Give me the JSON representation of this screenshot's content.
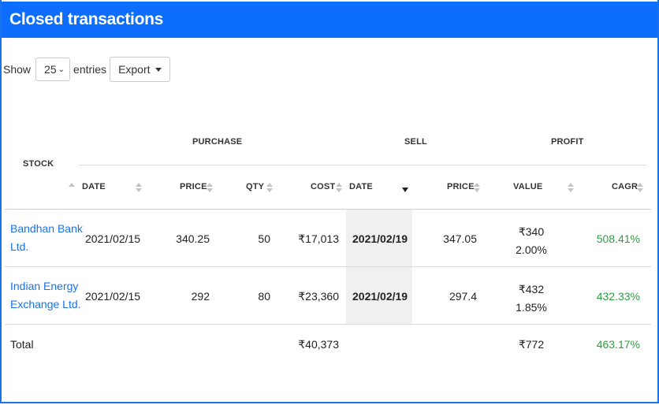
{
  "header": {
    "title": "Closed transactions"
  },
  "controls": {
    "show_label": "Show",
    "entries_value": "25",
    "entries_label": "entries",
    "export_label": "Export"
  },
  "groups": {
    "purchase": "PURCHASE",
    "sell": "SELL",
    "profit": "PROFIT"
  },
  "columns": {
    "stock": "STOCK",
    "purchase_date": "DATE",
    "purchase_price": "PRICE",
    "qty": "QTY",
    "cost": "COST",
    "sell_date": "DATE",
    "sell_price": "PRICE",
    "value": "VALUE",
    "cagr": "CAGR"
  },
  "rows": [
    {
      "stock_line1": "Bandhan Bank",
      "stock_line2": "Ltd.",
      "purchase_date": "2021/02/15",
      "purchase_price": "340.25",
      "qty": "50",
      "cost": "₹17,013",
      "sell_date": "2021/02/19",
      "sell_price": "347.05",
      "value": "₹340",
      "value_pct": "2.00%",
      "cagr": "508.41%"
    },
    {
      "stock_line1": "Indian Energy",
      "stock_line2": "Exchange Ltd.",
      "purchase_date": "2021/02/15",
      "purchase_price": "292",
      "qty": "80",
      "cost": "₹23,360",
      "sell_date": "2021/02/19",
      "sell_price": "297.4",
      "value": "₹432",
      "value_pct": "1.85%",
      "cagr": "432.33%"
    }
  ],
  "total": {
    "label": "Total",
    "cost": "₹40,373",
    "value": "₹772",
    "cagr": "463.17%"
  },
  "colors": {
    "header_bg": "#0d6efd",
    "link": "#1a73e8",
    "positive": "#2e9e44"
  }
}
